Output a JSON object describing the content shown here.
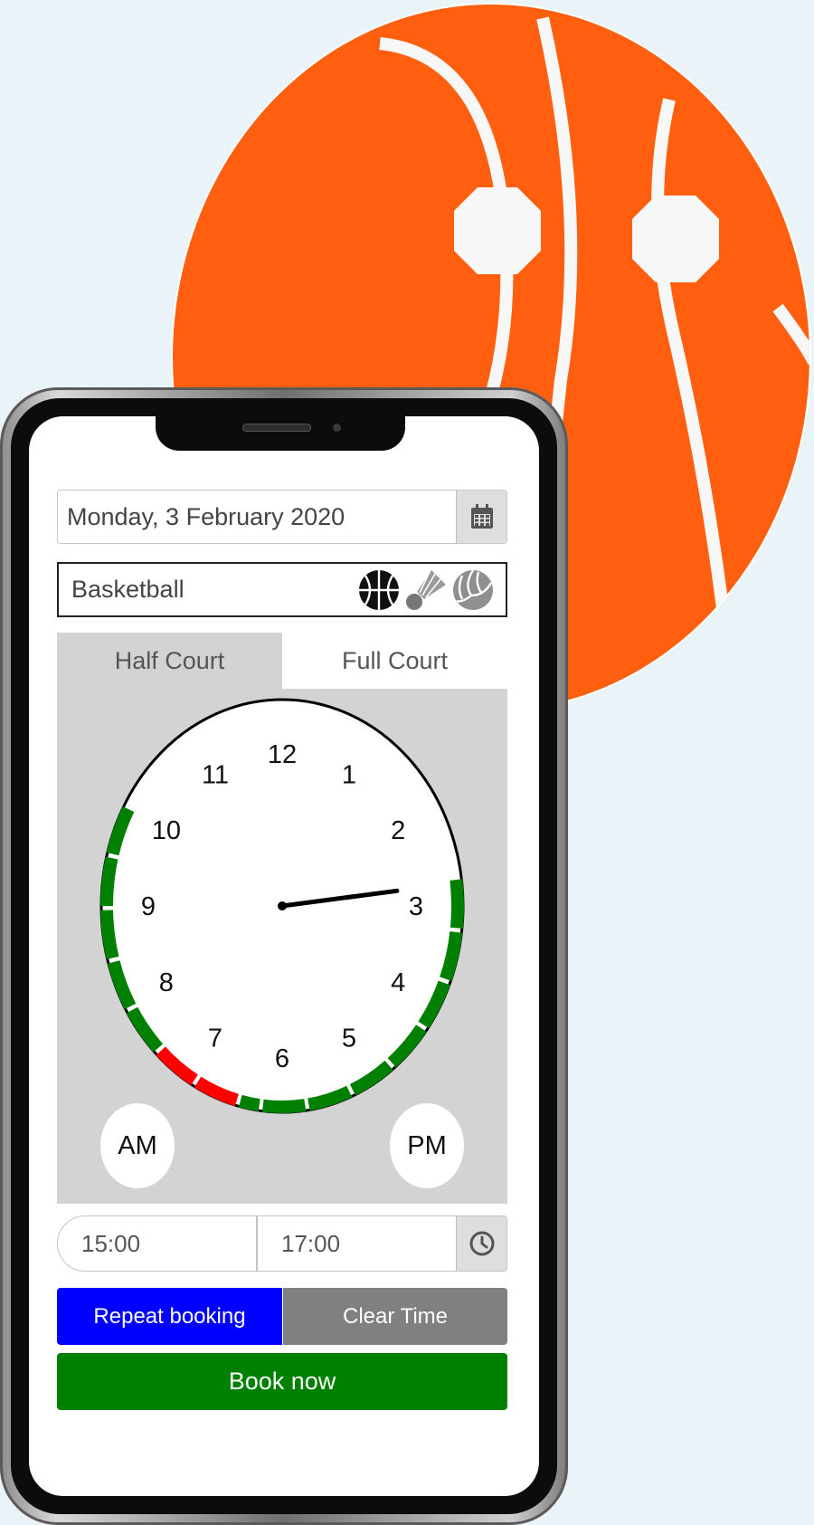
{
  "booking": {
    "date": "Monday, 3 February 2020",
    "sport": "Basketball",
    "sport_icons": [
      "basketball-icon",
      "shuttlecock-icon",
      "volleyball-icon"
    ],
    "tabs": [
      {
        "label": "Half Court",
        "active": true
      },
      {
        "label": "Full Court",
        "active": false
      }
    ],
    "clock": {
      "numbers": [
        "12",
        "1",
        "2",
        "3",
        "4",
        "5",
        "6",
        "7",
        "8",
        "9",
        "10",
        "11"
      ],
      "hand_hour": 2.75,
      "available_color": "#008000",
      "booked_color": "#ff0000",
      "am_label": "AM",
      "pm_label": "PM"
    },
    "start_time": "15:00",
    "end_time": "17:00",
    "repeat_label": "Repeat booking",
    "clear_label": "Clear Time",
    "book_label": "Book now"
  },
  "colors": {
    "brand_orange": "#ff5f0f",
    "repeat_blue": "#0000ff",
    "clear_gray": "#808080",
    "book_green": "#008000",
    "background": "#eaf3f7"
  },
  "logo_icon": "basketball-logo-icon"
}
